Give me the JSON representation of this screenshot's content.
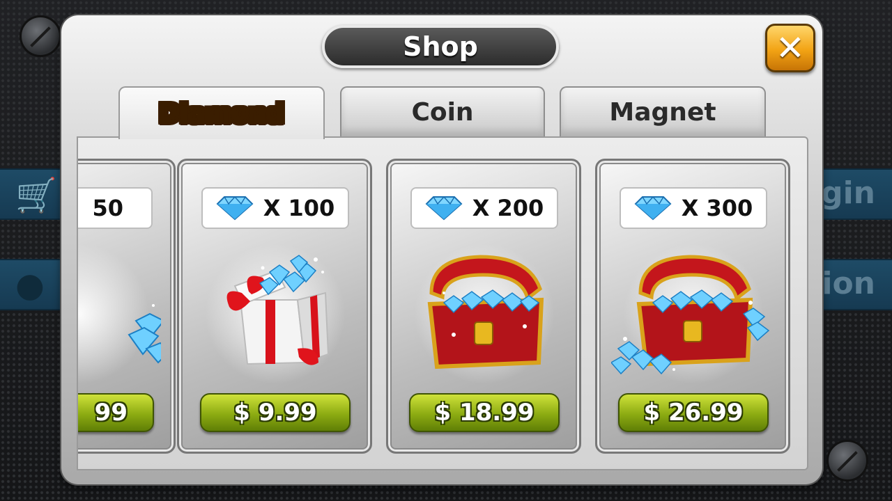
{
  "background": {
    "strip1_text": "gin",
    "strip2_text": "tion"
  },
  "title": "Shop",
  "close_label": "✕",
  "tabs": [
    {
      "label": "Diamond",
      "active": true
    },
    {
      "label": "Coin",
      "active": false
    },
    {
      "label": "Magnet",
      "active": false
    }
  ],
  "cards": [
    {
      "quantity": "50",
      "price": "99",
      "art": "gems-pile-icon"
    },
    {
      "quantity": "X 100",
      "price": "$ 9.99",
      "art": "gift-box-icon"
    },
    {
      "quantity": "X 200",
      "price": "$ 18.99",
      "art": "treasure-chest-icon"
    },
    {
      "quantity": "X 300",
      "price": "$ 26.99",
      "art": "treasure-chest-overflow-icon"
    }
  ],
  "colors": {
    "accent_gold": "#f2a314",
    "price_green": "#8cab12",
    "gem_blue": "#4fc3ff",
    "chest_red": "#c4161c"
  }
}
